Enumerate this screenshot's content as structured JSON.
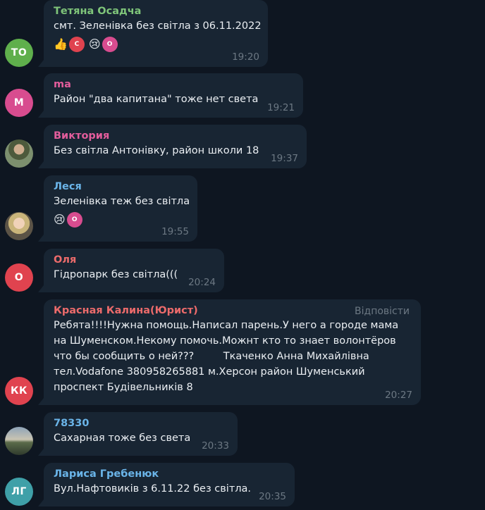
{
  "messages": [
    {
      "avatar": {
        "initials": "ТО",
        "color": "#5faf4c"
      },
      "name": "Тетяна Осадча",
      "name_color": "#7fc57a",
      "lines": [
        "смт. Зеленівка без світла з 06.11.2022"
      ],
      "reactions": [
        {
          "emoji": "👍",
          "user_initial": "С",
          "user_color": "#e0434f"
        },
        {
          "emoji": "😢",
          "user_initial": "О",
          "user_color": "#d84c8f"
        }
      ],
      "time": "19:20"
    },
    {
      "avatar": {
        "initials": "М",
        "color": "#d84c8f"
      },
      "name": "ma",
      "name_color": "#e35d9c",
      "lines": [
        "Район \"два капитана\" тоже нет света"
      ],
      "time": "19:21"
    },
    {
      "avatar": {
        "initials": "",
        "color": "#7c8f6e",
        "photo": "photo-a"
      },
      "name": "Виктория",
      "name_color": "#e35d9c",
      "lines": [
        "Без світла Антонівку, район школи 18"
      ],
      "time": "19:37"
    },
    {
      "avatar": {
        "initials": "",
        "color": "#c9b47a",
        "photo": "photo-b"
      },
      "name": "Леся",
      "name_color": "#6ab4e8",
      "lines": [
        "Зеленівка теж без світла"
      ],
      "reactions": [
        {
          "emoji": "😢",
          "user_initial": "О",
          "user_color": "#d84c8f"
        }
      ],
      "time": "19:55"
    },
    {
      "avatar": {
        "initials": "О",
        "color": "#e0434f"
      },
      "name": "Оля",
      "name_color": "#ec6b6b",
      "lines": [
        "Гідропарк без світла((("
      ],
      "time": "20:24"
    },
    {
      "avatar": {
        "initials": "КК",
        "color": "#e0434f"
      },
      "name": "Красная Калина(Юрист)",
      "name_color": "#ec6b6b",
      "reply_label": "Відповісти",
      "lines": [
        "Ребята!!!!Нужна помощь.Написал парень.У него а городе мама",
        "на Шуменском.Некому помочь.Можнт кто то знает волонтёров",
        "что бы сообщить о ней???         Ткаченко Анна Михайлівна",
        "тел.Vodafone 380958265881 м.Херсон район Шуменський",
        "проспект Будівельників 8"
      ],
      "time": "20:27"
    },
    {
      "avatar": {
        "initials": "",
        "color": "#5b6b4a",
        "photo": "photo-c"
      },
      "name": "78330",
      "name_color": "#6ab4e8",
      "lines": [
        "Сахарная тоже без света"
      ],
      "time": "20:33"
    },
    {
      "avatar": {
        "initials": "ЛГ",
        "color": "#3fa0a8"
      },
      "name": "Лариса Гребенюк",
      "name_color": "#6ab4e8",
      "lines": [
        "Вул.Нафтовиків з 6.11.22 без світла."
      ],
      "time": "20:35"
    }
  ]
}
